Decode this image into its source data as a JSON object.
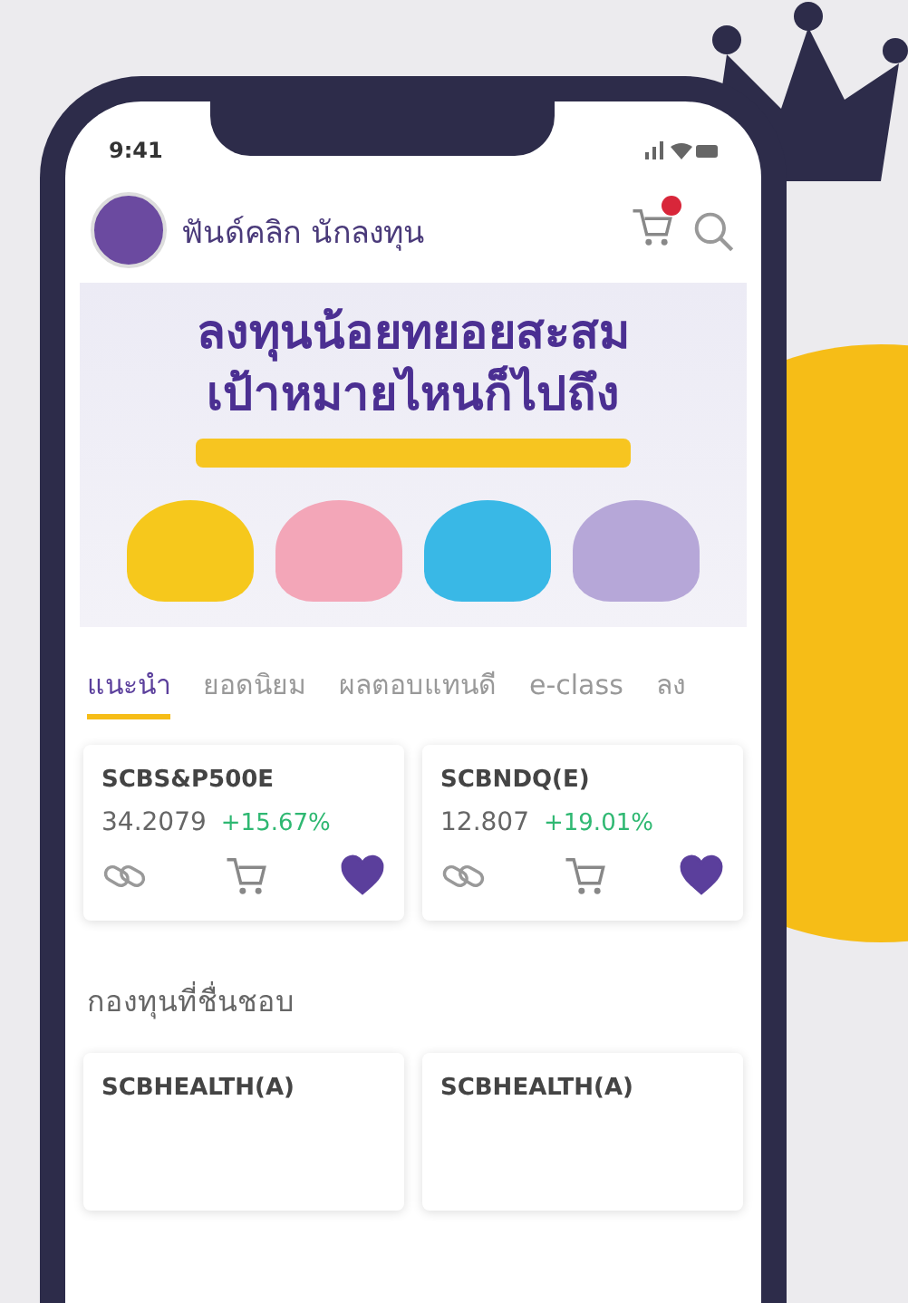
{
  "status_bar": {
    "time": "9:41"
  },
  "header": {
    "name": "ฟันด์คลิก นักลงทุน"
  },
  "banner": {
    "headline": [
      "ลงทุนน้อยทยอยสะสม",
      "เป้าหมายไหนก็ไปถึง"
    ]
  },
  "tabs": [
    {
      "label": "แนะนำ",
      "selected": true
    },
    {
      "label": "ยอดนิยม",
      "selected": false
    },
    {
      "label": "ผลตอบแทนดี",
      "selected": false
    },
    {
      "label": "e-class",
      "selected": false
    },
    {
      "label": "ลง",
      "selected": false
    }
  ],
  "funds": [
    {
      "name": "SCBS&P500E",
      "price": "34.2079",
      "change": "+15.67%",
      "favorite": true
    },
    {
      "name": "SCBNDQ(E)",
      "price": "12.807",
      "change": "+19.01%",
      "favorite": true
    }
  ],
  "favorites": {
    "title": "กองทุนที่ชื่นชอบ",
    "funds": [
      {
        "name": "SCBHEALTH(A)"
      },
      {
        "name": "SCBHEALTH(A)"
      }
    ]
  }
}
